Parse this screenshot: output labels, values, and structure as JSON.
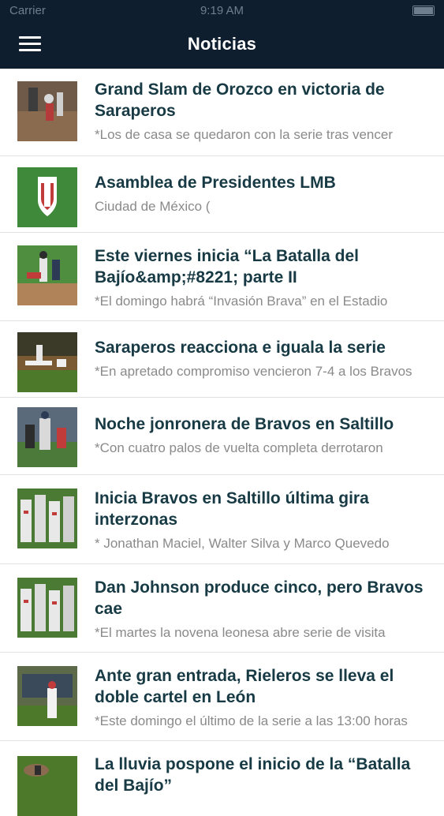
{
  "status_bar": {
    "carrier": "Carrier",
    "time": "9:19 AM"
  },
  "header": {
    "title": "Noticias",
    "menu_icon": "hamburger-menu-icon"
  },
  "colors": {
    "header_bg": "#0f1e2e",
    "headline": "#173a44",
    "summary": "#8a8a8a",
    "divider": "#e1e1e1"
  },
  "news": [
    {
      "headline": "Grand Slam de Orozco en victoria de Saraperos",
      "summary": "*Los de casa se quedaron con la serie tras vencer"
    },
    {
      "headline": "Asamblea de Presidentes LMB",
      "summary": "Ciudad de México ("
    },
    {
      "headline": "Este viernes inicia “La Batalla del Bajío&amp;#8221; parte II",
      "summary": "*El domingo habrá “Invasión Brava” en el Estadio"
    },
    {
      "headline": "Saraperos reacciona e iguala la serie",
      "summary": "*En apretado compromiso vencieron 7-4 a los Bravos"
    },
    {
      "headline": "Noche jonronera de Bravos en Saltillo",
      "summary": "*Con cuatro palos de vuelta completa derrotaron"
    },
    {
      "headline": "Inicia Bravos en Saltillo última gira interzonas",
      "summary": "* Jonathan Maciel, Walter Silva y Marco Quevedo"
    },
    {
      "headline": "Dan Johnson produce cinco, pero Bravos cae",
      "summary": "*El martes la novena leonesa abre serie de visita"
    },
    {
      "headline": "Ante gran entrada, Rieleros se lleva el doble cartel en León",
      "summary": "*Este domingo el último de la serie a las 13:00 horas"
    },
    {
      "headline": "La lluvia pospone el inicio de la “Batalla del Bajío”",
      "summary": ""
    }
  ]
}
